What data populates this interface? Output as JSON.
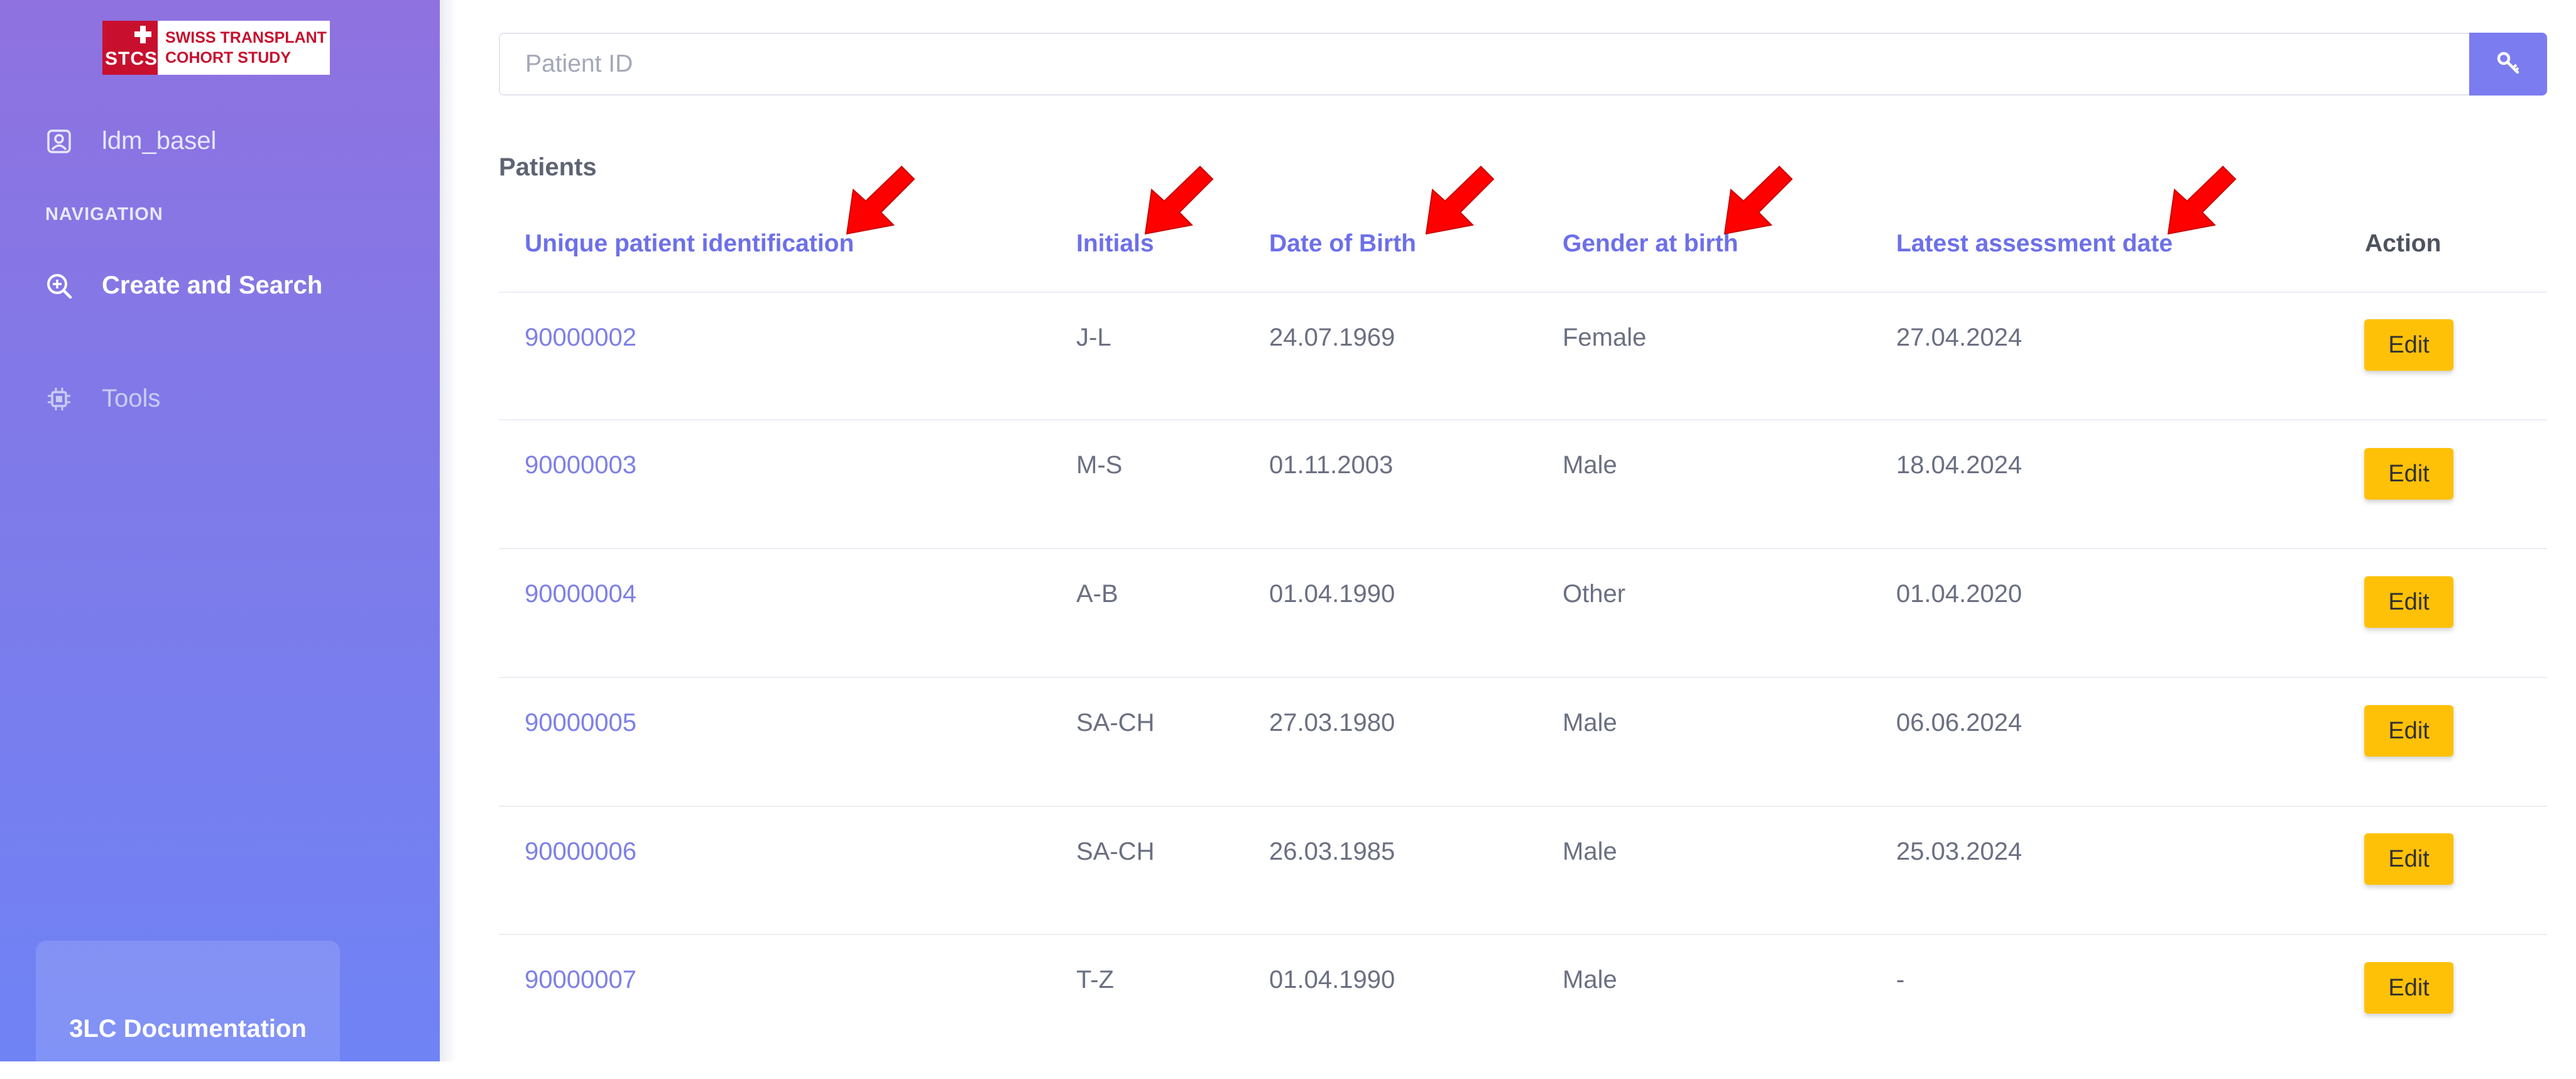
{
  "sidebar": {
    "logo": {
      "abbr": "STCS",
      "line1": "SWISS TRANSPLANT",
      "line2": "COHORT STUDY"
    },
    "user": {
      "name": "ldm_basel",
      "icon": "user-badge-icon"
    },
    "nav_heading": "NAVIGATION",
    "items": [
      {
        "label": "Create and Search",
        "icon": "search-plus-icon",
        "active": true
      },
      {
        "label": "Tools",
        "icon": "chip-icon",
        "active": false
      }
    ],
    "doc_button": "3LC Documentation"
  },
  "search": {
    "placeholder": "Patient ID",
    "value": "",
    "button_icon": "key-icon"
  },
  "patients": {
    "title": "Patients",
    "columns": [
      "Unique patient identification",
      "Initials",
      "Date of Birth",
      "Gender at birth",
      "Latest assessment date",
      "Action"
    ],
    "rows": [
      {
        "id": "90000002",
        "initials": "J-L",
        "dob": "24.07.1969",
        "gender": "Female",
        "latest": "27.04.2024",
        "action": "Edit"
      },
      {
        "id": "90000003",
        "initials": "M-S",
        "dob": "01.11.2003",
        "gender": "Male",
        "latest": "18.04.2024",
        "action": "Edit"
      },
      {
        "id": "90000004",
        "initials": "A-B",
        "dob": "01.04.1990",
        "gender": "Other",
        "latest": "01.04.2020",
        "action": "Edit"
      },
      {
        "id": "90000005",
        "initials": "SA-CH",
        "dob": "27.03.1980",
        "gender": "Male",
        "latest": "06.06.2024",
        "action": "Edit"
      },
      {
        "id": "90000006",
        "initials": "SA-CH",
        "dob": "26.03.1985",
        "gender": "Male",
        "latest": "25.03.2024",
        "action": "Edit"
      },
      {
        "id": "90000007",
        "initials": "T-Z",
        "dob": "01.04.1990",
        "gender": "Male",
        "latest": "-",
        "action": "Edit"
      }
    ]
  },
  "colors": {
    "accent": "#7b7cf0",
    "link": "#6d70e8",
    "edit_button": "#ffc107",
    "annotation_arrow": "#ff0000"
  }
}
